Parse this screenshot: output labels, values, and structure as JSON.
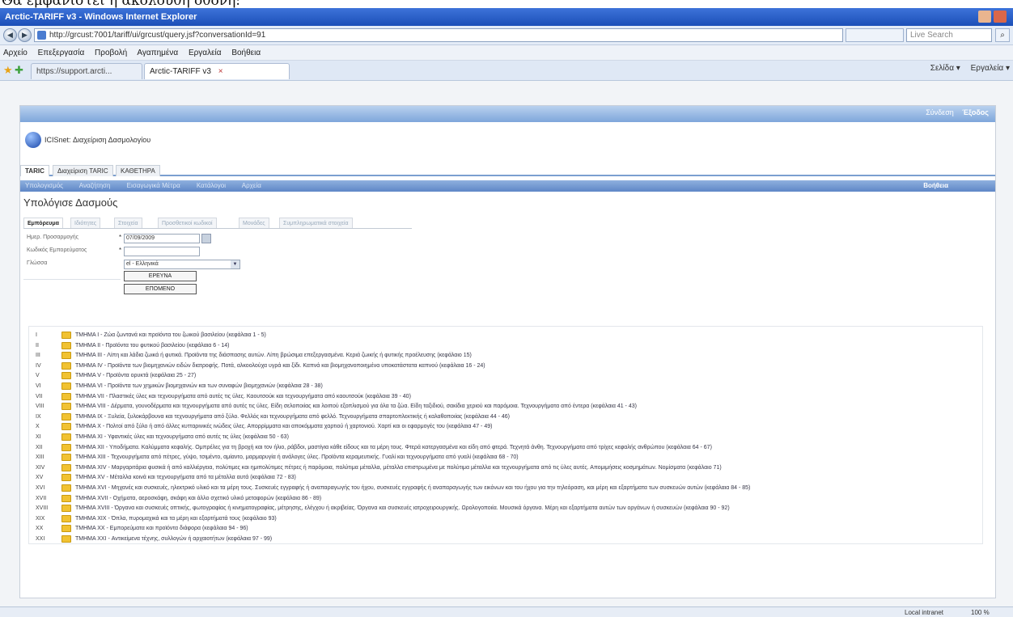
{
  "caption": "Θα εμφανιστεί η ακόλουθη οθόνη:",
  "window": {
    "title": "Arctic-TARIFF v3 - Windows Internet Explorer"
  },
  "browser": {
    "back_icon": "back-arrow-icon",
    "forward_icon": "forward-arrow-icon",
    "url": "http://grcust:7001/tariff/ui/grcust/query.jsf?conversationId=91",
    "search_placeholder": "Live Search",
    "menu": [
      "Αρχείο",
      "Επεξεργασία",
      "Προβολή",
      "Αγαπημένα",
      "Εργαλεία",
      "Βοήθεια"
    ],
    "tabs": [
      {
        "label": "https://support.arcti..."
      },
      {
        "label": "Arctic-TARIFF v3",
        "close": "×"
      }
    ],
    "commands": [
      "Σελίδα ▾",
      "Εργαλεία ▾"
    ],
    "status": {
      "zone": "Local intranet",
      "zoom": "100 %"
    }
  },
  "app": {
    "banner_user": "Σύνδεση",
    "banner_action": "Έξοδος",
    "title": "ICISnet: Διαχείριση Δασμολογίου",
    "module_tabs": [
      "TARIC",
      "Διαχείριση TARIC",
      "ΚΑΘΕΤΗΡΑ"
    ],
    "nav_items": [
      "Υπολογισμός",
      "Αναζήτηση",
      "Εισαγωγικά Μέτρα",
      "Κατάλογοι",
      "Αρχεία"
    ],
    "help_label": "Βοήθεια",
    "section_title": "Υπολόγισε Δασμούς",
    "sub_tabs": [
      "Εμπόρευμα",
      "Ιδιότητες",
      "Στοιχεία",
      "Προσθετικοί κωδικοί",
      "Μονάδες",
      "Συμπληρωματικά στοιχεία"
    ],
    "form": {
      "date_label": "Ημερ. Προσαρμογής",
      "date_value": "07/09/2009",
      "code_label": "Κωδικός Εμπορεύματος",
      "code_value": "",
      "language_label": "Γλώσσα",
      "language_value": "el - Ελληνικά",
      "search_button": "ΕΡΕΥΝΑ",
      "next_button": "ΕΠΟΜΕΝΟ"
    },
    "sections": [
      {
        "numeral": "I",
        "label": "ΤΜΗΜΑ I - Ζώα ζωντανά και προϊόντα του ζωικού βασιλείου (κεφάλαια 1 - 5)"
      },
      {
        "numeral": "II",
        "label": "ΤΜΗΜΑ II - Προϊόντα του φυτικού βασιλείου (κεφάλαια 6 - 14)"
      },
      {
        "numeral": "III",
        "label": "ΤΜΗΜΑ III - Λίπη και λάδια ζωικά ή φυτικά. Προϊόντα της διάσπασης αυτών. Λίπη βρώσιμα επεξεργασμένα. Κεριά ζωικής ή φυτικής προέλευσης (κεφάλαιο 15)"
      },
      {
        "numeral": "IV",
        "label": "ΤΜΗΜΑ IV - Προϊόντα των βιομηχανιών ειδών διατροφής. Ποτά, αλκοολούχα υγρά και ξίδι. Καπνά και βιομηχανοποιημένα υποκατάστατα καπνού (κεφάλαια 16 - 24)"
      },
      {
        "numeral": "V",
        "label": "ΤΜΗΜΑ V - Προϊόντα ορυκτά (κεφάλαια 25 - 27)"
      },
      {
        "numeral": "VI",
        "label": "ΤΜΗΜΑ VI - Προϊόντα των χημικών βιομηχανιών και των συναφών βιομηχανιών (κεφάλαια 28 - 38)"
      },
      {
        "numeral": "VII",
        "label": "ΤΜΗΜΑ VII - Πλαστικές ύλες και τεχνουργήματα από αυτές τις ύλες. Καουτσούκ και τεχνουργήματα από καουτσούκ (κεφάλαια 39 - 40)"
      },
      {
        "numeral": "VIII",
        "label": "ΤΜΗΜΑ VIII - Δέρματα, γουνοδέρματα και τεχνουργήματα από αυτές τις ύλες. Είδη σελοποιίας και λοιπού εξοπλισμού για όλα τα ζώα. Είδη ταξιδιού, σακίδια χεριού και παρόμοια. Τεχνουργήματα από έντερα (κεφάλαια 41 - 43)"
      },
      {
        "numeral": "IX",
        "label": "ΤΜΗΜΑ IX - Ξυλεία, ξυλοκάρβουνα και τεχνουργήματα από ξύλο. Φελλός και τεχνουργήματα από φελλό. Τεχνουργήματα σπαρτοπλεκτικής ή καλαθοποιίας (κεφάλαια 44 - 46)"
      },
      {
        "numeral": "X",
        "label": "ΤΜΗΜΑ X - Πολτοί από ξύλο ή από άλλες κυτταρινικές ινώδεις ύλες. Απορρίμματα και αποκόμματα χαρτιού ή χαρτονιού. Χαρτί και οι εφαρμογές του (κεφάλαια 47 - 49)"
      },
      {
        "numeral": "XI",
        "label": "ΤΜΗΜΑ XI - Υφαντικές ύλες και τεχνουργήματα από αυτές τις ύλες (κεφάλαια 50 - 63)"
      },
      {
        "numeral": "XII",
        "label": "ΤΜΗΜΑ XII - Υποδήματα. Καλύμματα κεφαλής. Ομπρέλες για τη βροχή και τον ήλιο, ράβδοι, μαστίγια κάθε είδους και τα μέρη τους. Φτερά κατεργασμένα και είδη από φτερά. Τεχνητά άνθη. Τεχνουργήματα από τρίχες κεφαλής ανθρώπου (κεφάλαια 64 - 67)"
      },
      {
        "numeral": "XIII",
        "label": "ΤΜΗΜΑ XIII - Τεχνουργήματα από πέτρες, γύψο, τσιμέντο, αμίαντο, μαρμαρυγία ή ανάλογες ύλες. Προϊόντα κεραμευτικής. Γυαλί και τεχνουργήματα από γυαλί (κεφάλαια 68 - 70)"
      },
      {
        "numeral": "XIV",
        "label": "ΤΜΗΜΑ XIV - Μαργαριτάρια φυσικά ή από καλλιέργεια, πολύτιμες και ημιπολύτιμες πέτρες ή παρόμοια, πολύτιμα μέταλλα, μέταλλα επιστρωμένα με πολύτιμα μέταλλα και τεχνουργήματα από τις ύλες αυτές. Απομιμήσεις κοσμημάτων. Νομίσματα (κεφάλαιο 71)"
      },
      {
        "numeral": "XV",
        "label": "ΤΜΗΜΑ XV - Μέταλλα κοινά και τεχνουργήματα από τα μέταλλα αυτά (κεφάλαια 72 - 83)"
      },
      {
        "numeral": "XVI",
        "label": "ΤΜΗΜΑ XVI - Μηχανές και συσκευές, ηλεκτρικό υλικό και τα μέρη τους. Συσκευές εγγραφής ή αναπαραγωγής του ήχου, συσκευές εγγραφής ή αναπαραγωγής των εικόνων και του ήχου για την τηλεόραση, και μέρη και εξαρτήματα των συσκευών αυτών (κεφάλαια 84 - 85)"
      },
      {
        "numeral": "XVII",
        "label": "ΤΜΗΜΑ XVII - Οχήματα, αεροσκάφη, σκάφη και άλλο σχετικό υλικό μεταφορών (κεφάλαια 86 - 89)"
      },
      {
        "numeral": "XVIII",
        "label": "ΤΜΗΜΑ XVIII - Όργανα και συσκευές οπτικής, φωτογραφίας ή κινηματογραφίας, μέτρησης, ελέγχου ή ακριβείας. Όργανα και συσκευές ιατροχειρουργικής. Ωρολογοποιία. Μουσικά όργανα. Μέρη και εξαρτήματα αυτών των οργάνων ή συσκευών (κεφάλαια 90 - 92)"
      },
      {
        "numeral": "XIX",
        "label": "ΤΜΗΜΑ XIX - Όπλα, πυρομαχικά και τα μέρη και εξαρτήματά τους (κεφάλαιο 93)"
      },
      {
        "numeral": "XX",
        "label": "ΤΜΗΜΑ XX - Εμπορεύματα και προϊόντα διάφορα (κεφάλαια 94 - 96)"
      },
      {
        "numeral": "XXI",
        "label": "ΤΜΗΜΑ XXI - Αντικείμενα τέχνης, συλλογών ή αρχαιοτήτων (κεφάλαια 97 - 99)"
      }
    ]
  },
  "colors": {
    "titlebar": "#1c4fb8",
    "banner": "#7ea6db",
    "folder": "#f1c232"
  }
}
